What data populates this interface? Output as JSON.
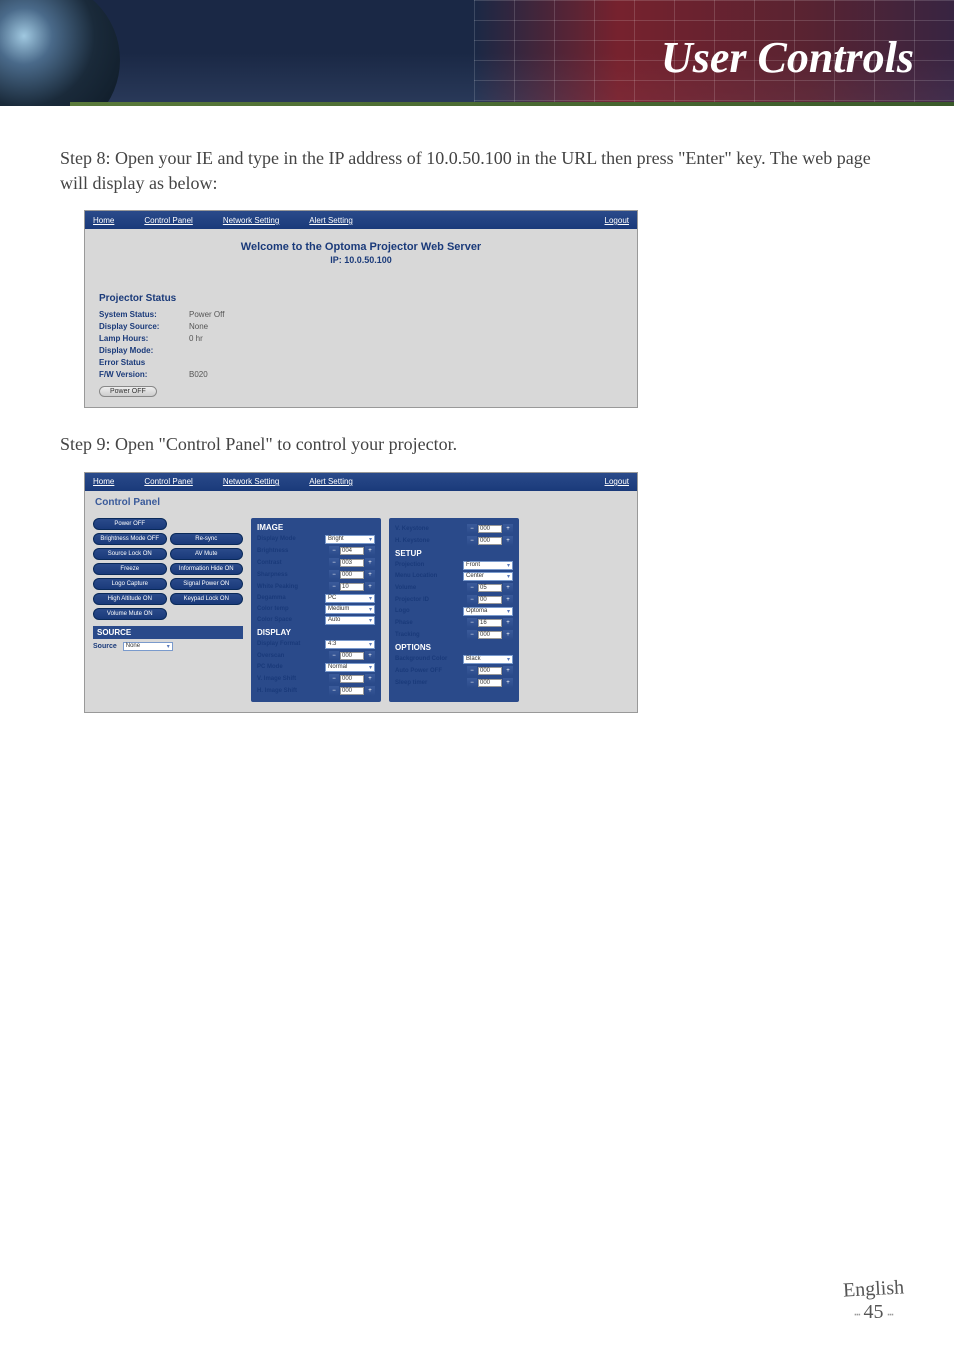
{
  "header": {
    "title": "User Controls"
  },
  "step8": {
    "label": "Step 8:",
    "text": "Open your IE and type in the IP address of 10.0.50.100 in the URL then press \"Enter\" key. The web page will display as below:"
  },
  "step9": {
    "label": "Step 9:",
    "text": "Open \"Control Panel\" to control your projector."
  },
  "nav": {
    "home": "Home",
    "control_panel": "Control Panel",
    "network_setting": "Network Setting",
    "alert_setting": "Alert Setting",
    "logout": "Logout"
  },
  "welcome": {
    "title": "Welcome to the Optoma Projector Web Server",
    "ip": "IP: 10.0.50.100"
  },
  "status": {
    "section_title": "Projector Status",
    "rows": {
      "system_status": {
        "label": "System Status:",
        "value": "Power Off"
      },
      "display_source": {
        "label": "Display Source:",
        "value": "None"
      },
      "lamp_hours": {
        "label": "Lamp Hours:",
        "value": "0 hr"
      },
      "display_mode": {
        "label": "Display Mode:",
        "value": ""
      },
      "error_status": {
        "label": "Error Status",
        "value": ""
      },
      "fw_version": {
        "label": "F/W Version:",
        "value": "B020"
      }
    },
    "power_btn": "Power OFF"
  },
  "cp": {
    "title": "Control Panel",
    "left_buttons": [
      "Power OFF",
      "",
      "Brightness Mode OFF",
      "Re-sync",
      "Source Lock ON",
      "AV Mute",
      "Freeze",
      "Information Hide ON",
      "Logo Capture",
      "Signal Power ON",
      "High Altitude ON",
      "Keypad Lock ON",
      "Volume Mute ON",
      ""
    ],
    "source_section": {
      "title": "SOURCE",
      "label": "Source",
      "value": "None"
    },
    "image": {
      "hdr": "IMAGE",
      "display_mode": {
        "label": "Display Mode",
        "value": "Bright"
      },
      "brightness": {
        "label": "Brightness",
        "value": "004"
      },
      "contrast": {
        "label": "Contrast",
        "value": "003"
      },
      "sharpness": {
        "label": "Sharpness",
        "value": "000"
      },
      "white_peaking": {
        "label": "White Peaking",
        "value": "10"
      },
      "degamma": {
        "label": "Degamma",
        "value": "PC"
      },
      "color_temp": {
        "label": "Color temp",
        "value": "Medium"
      },
      "color_space": {
        "label": "Color Space",
        "value": "Auto"
      }
    },
    "display": {
      "hdr": "DISPLAY",
      "display_format": {
        "label": "Display Format",
        "value": "4:3"
      },
      "overscan": {
        "label": "Overscan",
        "value": "000"
      },
      "pc_mode": {
        "label": "PC Mode",
        "value": "Normal"
      },
      "v_image_shift": {
        "label": "V. Image Shift",
        "value": "000"
      },
      "h_image_shift": {
        "label": "H. Image Shift",
        "value": "000"
      }
    },
    "setup": {
      "v_keystone": {
        "label": "V. Keystone",
        "value": "000"
      },
      "h_keystone": {
        "label": "H. Keystone",
        "value": "000"
      },
      "hdr": "SETUP",
      "projection": {
        "label": "Projection",
        "value": "Front"
      },
      "menu_location": {
        "label": "Menu Location",
        "value": "Center"
      },
      "volume": {
        "label": "Volume",
        "value": "05"
      },
      "projector_id": {
        "label": "Projector ID",
        "value": "00"
      },
      "logo": {
        "label": "Logo",
        "value": "Optoma"
      },
      "phase": {
        "label": "Phase",
        "value": "16"
      },
      "tracking": {
        "label": "Tracking",
        "value": "000"
      }
    },
    "options": {
      "hdr": "OPTIONS",
      "background_color": {
        "label": "Background Color",
        "value": "Black"
      },
      "auto_power_off": {
        "label": "Auto Power OFF",
        "value": "000"
      },
      "sleep_timer": {
        "label": "Sleep timer",
        "value": "000"
      }
    }
  },
  "footer": {
    "language": "English",
    "page": "45"
  }
}
